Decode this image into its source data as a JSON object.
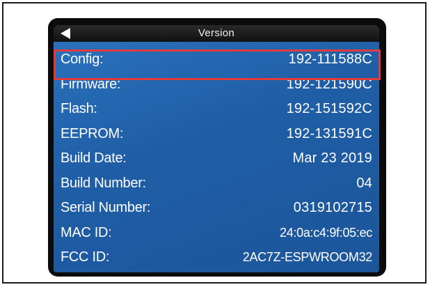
{
  "header": {
    "title": "Version",
    "back_icon": "back-arrow-icon"
  },
  "rows": [
    {
      "label": "Config:",
      "value": "192-111588C"
    },
    {
      "label": "Firmware:",
      "value": "192-121590C"
    },
    {
      "label": "Flash:",
      "value": "192-151592C"
    },
    {
      "label": "EEPROM:",
      "value": "192-131591C"
    },
    {
      "label": "Build Date:",
      "value": "Mar 23 2019"
    },
    {
      "label": "Build Number:",
      "value": "04"
    },
    {
      "label": "Serial Number:",
      "value": "0319102715"
    },
    {
      "label": "MAC ID:",
      "value": "24:0a:c4:9f:05:ec"
    },
    {
      "label": "FCC ID:",
      "value": "2AC7Z-ESPWROOM32"
    }
  ],
  "colors": {
    "screen_blue": "#1f5ea6",
    "header_bar": "#111111",
    "highlight_red": "#e23b3b",
    "text": "#ffffff"
  }
}
